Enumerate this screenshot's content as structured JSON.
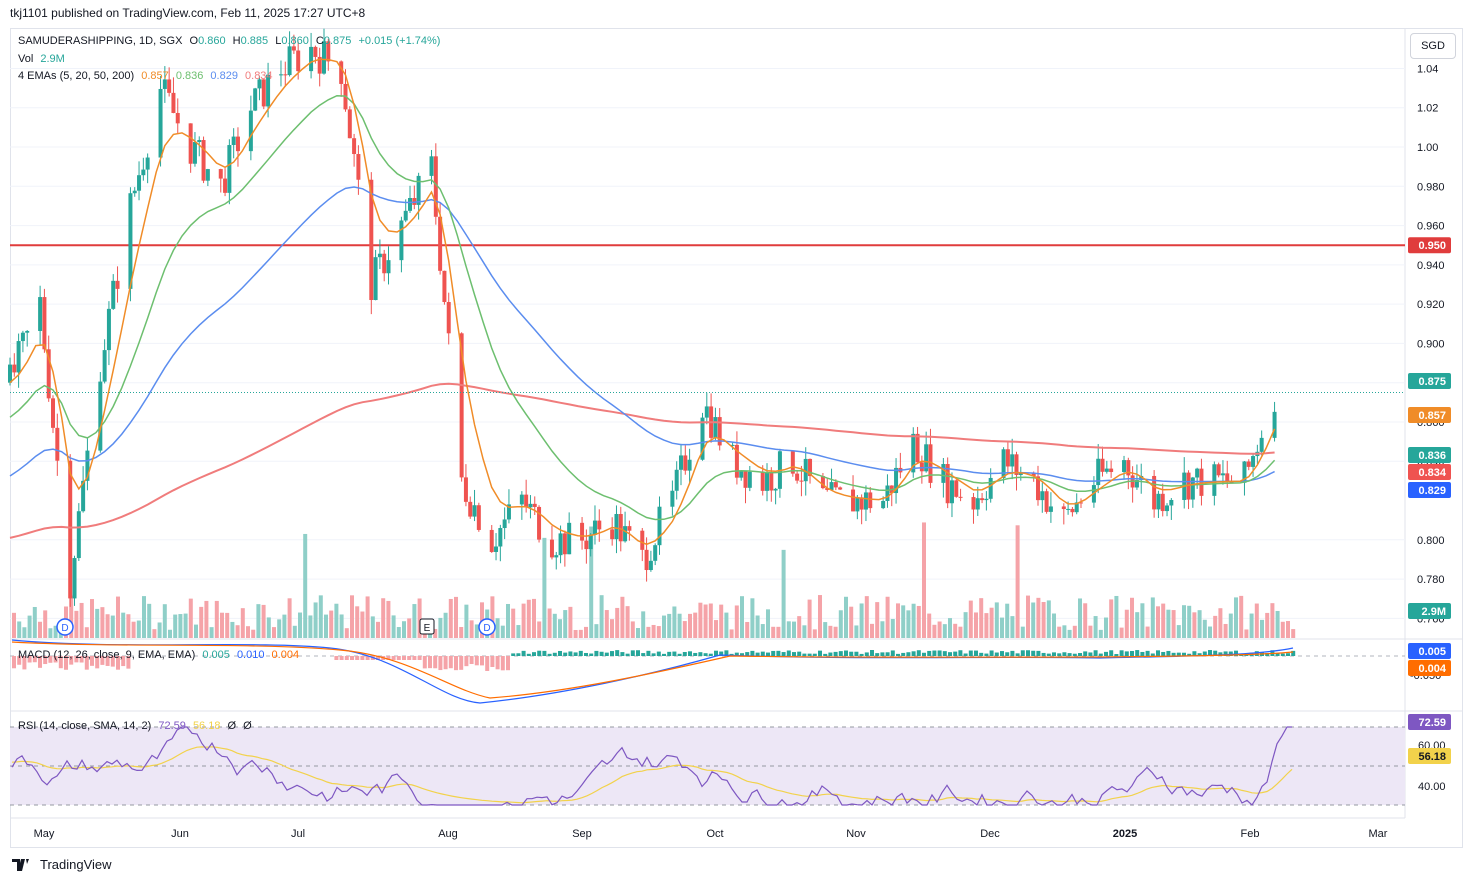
{
  "header": {
    "publisher": "tkj1101 published on TradingView.com, Feb 11, 2025 17:27 UTC+8"
  },
  "currency": "SGD",
  "footer": {
    "brand": "TradingView"
  },
  "legend": {
    "symbol": "SAMUDERASHIPPING, 1D, SGX",
    "o_label": "O",
    "o": "0.860",
    "h_label": "H",
    "h": "0.885",
    "l_label": "L",
    "l": "0.860",
    "c_label": "C",
    "c": "0.875",
    "change": "+0.015 (+1.74%)",
    "vol_label": "Vol",
    "vol": "2.9M",
    "ema_label": "4 EMAs (5, 20, 50, 200)",
    "ema5": "0.857",
    "ema20": "0.836",
    "ema50": "0.829",
    "ema200": "0.834",
    "macd_label": "MACD (12, 26, close, 9, EMA, EMA)",
    "macd_hist": "0.005",
    "macd_line": "0.010",
    "macd_signal": "0.004",
    "rsi_label": "RSI (14, close, SMA, 14, 2)",
    "rsi": "72.59",
    "rsi_sma": "56.18",
    "rsi_extra1": "Ø",
    "rsi_extra2": "Ø"
  },
  "colors": {
    "up": "#26a69a",
    "down": "#ef5350",
    "vol_up": "#8fcfc8",
    "vol_down": "#f5a3a8",
    "ema5": "#f08c28",
    "ema20": "#6dbf6f",
    "ema50": "#5b8def",
    "ema200": "#f07c7c",
    "resistance": "#e03c3c",
    "macd_line": "#2962ff",
    "macd_signal": "#ff6d00",
    "rsi": "#7e57c2",
    "rsi_sma": "#f2d24b",
    "rsi_band": "#ede7f6"
  },
  "price_axis": [
    "1.04",
    "1.02",
    "1.00",
    "0.980",
    "0.960",
    "0.940",
    "0.920",
    "0.900",
    "0.880",
    "0.860",
    "0.840",
    "0.800",
    "0.780",
    "0.760"
  ],
  "macd_axis": [
    "-0.050"
  ],
  "rsi_axis": [
    "60.00",
    "40.00"
  ],
  "time_axis": [
    "May",
    "Jun",
    "Jul",
    "Aug",
    "Sep",
    "Oct",
    "Nov",
    "Dec",
    "2025",
    "Jan",
    "Feb",
    "Mar"
  ],
  "badges": {
    "resistance": "0.950",
    "close": "0.875",
    "ema5": "0.857",
    "ema20": "0.836",
    "ema200": "0.834",
    "ema50": "0.829",
    "vol": "2.9M",
    "macd1": "0.005",
    "macd2": "0.004",
    "rsi": "72.59",
    "rsi_sma": "56.18"
  },
  "events": [
    "D",
    "E",
    "D"
  ],
  "chart_data": {
    "type": "candlestick",
    "title": "SAMUDERASHIPPING, 1D, SGX",
    "resistance_line": 0.95,
    "ylim": [
      0.75,
      1.055
    ],
    "x_range": [
      "2024-04-22",
      "2025-03-10"
    ],
    "points": [
      [
        "2024-04-22",
        0.88
      ],
      [
        "2024-04-29",
        0.92
      ],
      [
        "2024-05-06",
        0.78
      ],
      [
        "2024-05-13",
        0.89
      ],
      [
        "2024-05-20",
        0.97
      ],
      [
        "2024-05-27",
        1.03
      ],
      [
        "2024-06-03",
        1.0
      ],
      [
        "2024-06-10",
        0.98
      ],
      [
        "2024-06-17",
        1.02
      ],
      [
        "2024-06-24",
        1.04
      ],
      [
        "2024-07-01",
        1.05
      ],
      [
        "2024-07-08",
        1.04
      ],
      [
        "2024-07-15",
        0.93
      ],
      [
        "2024-07-22",
        0.96
      ],
      [
        "2024-07-29",
        0.99
      ],
      [
        "2024-08-05",
        0.83
      ],
      [
        "2024-08-12",
        0.8
      ],
      [
        "2024-08-19",
        0.82
      ],
      [
        "2024-08-26",
        0.8
      ],
      [
        "2024-09-02",
        0.8
      ],
      [
        "2024-09-09",
        0.81
      ],
      [
        "2024-09-16",
        0.79
      ],
      [
        "2024-09-23",
        0.82
      ],
      [
        "2024-09-30",
        0.87
      ],
      [
        "2024-10-07",
        0.84
      ],
      [
        "2024-10-14",
        0.83
      ],
      [
        "2024-10-21",
        0.84
      ],
      [
        "2024-10-28",
        0.82
      ],
      [
        "2024-11-04",
        0.82
      ],
      [
        "2024-11-11",
        0.82
      ],
      [
        "2024-11-18",
        0.85
      ],
      [
        "2024-11-25",
        0.83
      ],
      [
        "2024-12-02",
        0.82
      ],
      [
        "2024-12-09",
        0.84
      ],
      [
        "2024-12-16",
        0.83
      ],
      [
        "2024-12-23",
        0.81
      ],
      [
        "2024-12-30",
        0.83
      ],
      [
        "2025-01-06",
        0.84
      ],
      [
        "2025-01-13",
        0.82
      ],
      [
        "2025-01-20",
        0.83
      ],
      [
        "2025-01-27",
        0.83
      ],
      [
        "2025-02-03",
        0.83
      ],
      [
        "2025-02-10",
        0.875
      ]
    ],
    "last": {
      "open": 0.86,
      "high": 0.885,
      "low": 0.86,
      "close": 0.875
    },
    "ema_last": {
      "ema5": 0.857,
      "ema20": 0.836,
      "ema50": 0.829,
      "ema200": 0.834
    },
    "volume_last": "2.9M",
    "macd_last": {
      "hist": 0.005,
      "macd": 0.01,
      "signal": 0.004
    },
    "rsi_last": {
      "rsi": 72.59,
      "sma": 56.18
    }
  }
}
